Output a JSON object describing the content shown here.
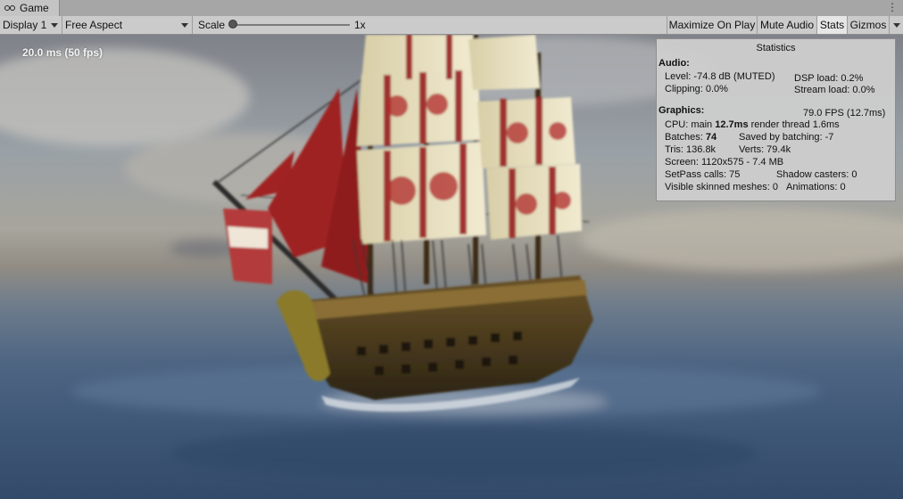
{
  "tab": {
    "icon": "gamepad-icon",
    "label": "Game",
    "menu_icon": "kebab-menu-icon",
    "menu_glyph": "⋮"
  },
  "toolbar": {
    "display": "Display 1",
    "aspect": "Free Aspect",
    "scale_label": "Scale",
    "scale_value": "1x",
    "maximize_on_play": "Maximize On Play",
    "mute_audio": "Mute Audio",
    "stats": "Stats",
    "gizmos": "Gizmos"
  },
  "viewport": {
    "fps_readout": "20.0 ms (50 fps)"
  },
  "statistics": {
    "title": "Statistics",
    "audio": {
      "heading": "Audio:",
      "level": "Level: -74.8 dB (MUTED)",
      "clipping": "Clipping: 0.0%",
      "dsp_load": "DSP load: 0.2%",
      "stream_load": "Stream load: 0.0%"
    },
    "graphics": {
      "heading": "Graphics:",
      "fps": "79.0 FPS (12.7ms)",
      "cpu_prefix": "CPU: main ",
      "cpu_main": "12.7ms",
      "cpu_render": " render thread 1.6ms",
      "batches_prefix": "Batches: ",
      "batches": "74",
      "saved_by_batching": "Saved by batching: -7",
      "tris": "Tris: 136.8k",
      "verts": "Verts: 79.4k",
      "screen": "Screen: 1120x575 - 7.4 MB",
      "setpass": "SetPass calls: 75",
      "shadow_casters": "Shadow casters: 0",
      "visible_skinned": "Visible skinned meshes: 0",
      "animations": "Animations: 0"
    }
  },
  "colors": {
    "accent_sail": "#efe7c2",
    "sail_red": "#9a2020",
    "hull": "#4a3a1f",
    "sea": "#3f5777"
  }
}
